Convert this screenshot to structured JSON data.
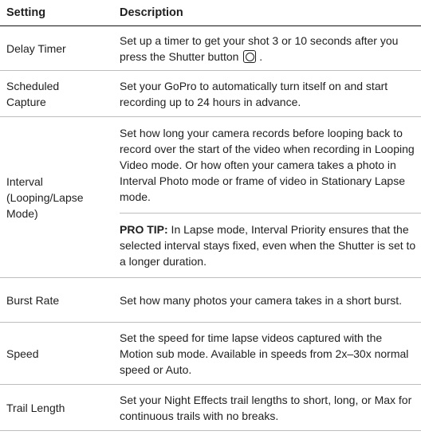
{
  "header": {
    "setting": "Setting",
    "description": "Description"
  },
  "rows": [
    {
      "setting": "Delay Timer",
      "description": "Set up a timer to get your shot 3 or 10 seconds after you press the Shutter button",
      "suffix": "."
    },
    {
      "setting": "Scheduled Capture",
      "description": "Set your GoPro to automatically turn itself on and start recording up to 24 hours in advance."
    },
    {
      "setting": "Interval (Looping/Lapse Mode)",
      "description": "Set how long your camera records before looping back to record over the start of the video when recording in Looping Video mode. Or how often your camera takes a photo in Interval Photo mode or frame of video in Stationary Lapse mode.",
      "tip_label": "PRO TIP:",
      "tip_text": " In Lapse mode, Interval Priority ensures that the selected interval stays fixed, even when the Shutter is set to a longer duration."
    },
    {
      "setting": "Burst Rate",
      "description": "Set how many photos your camera takes in a short burst."
    },
    {
      "setting": "Speed",
      "description": "Set the speed for time lapse videos captured with the Motion sub mode. Available in speeds from 2x–30x normal speed or Auto."
    },
    {
      "setting": "Trail Length",
      "description": "Set your Night Effects trail lengths to short, long, or Max for continuous trails with no breaks."
    }
  ]
}
